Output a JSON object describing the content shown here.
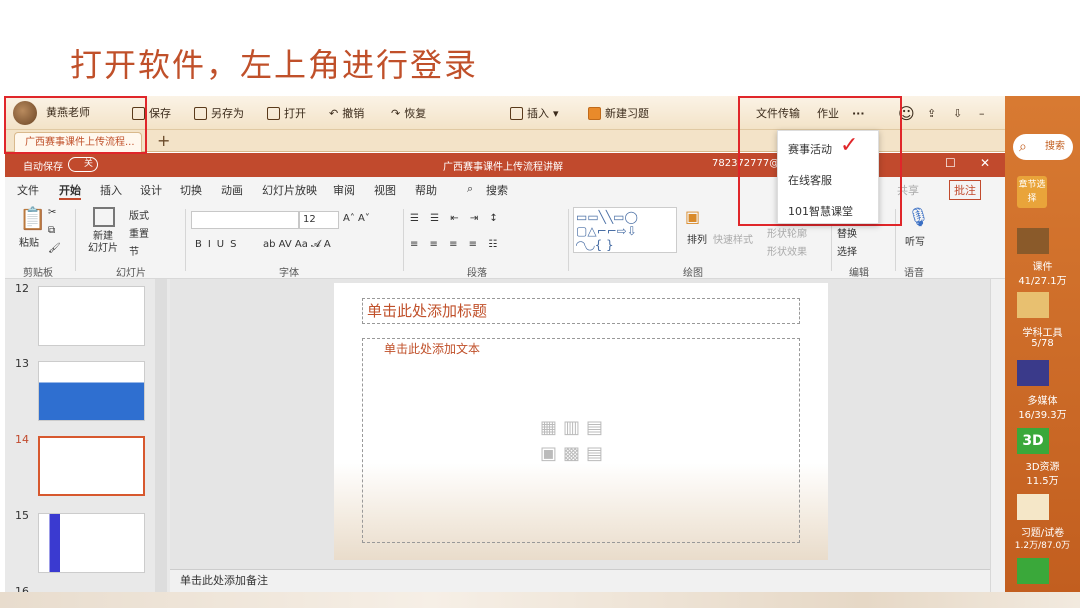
{
  "slide_title": "打开软件，左上角进行登录",
  "app_bar": {
    "user_name": "黄燕老师",
    "save": "保存",
    "save_as": "另存为",
    "open": "打开",
    "undo": "撤销",
    "redo": "恢复",
    "insert": "插入",
    "new_exercise": "新建习题",
    "file_transfer": "文件传输",
    "homework": "作业",
    "more": "···"
  },
  "doc_tab": {
    "label": "广西赛事课件上传流程..."
  },
  "new_tab": "+",
  "ppt": {
    "autosave": "自动保存",
    "autosave_state": "关",
    "window_title": "广西赛事课件上传流程讲解",
    "user": "782372777@q",
    "ribbon_tabs": [
      "文件",
      "开始",
      "插入",
      "设计",
      "切换",
      "动画",
      "幻灯片放映",
      "审阅",
      "视图",
      "帮助",
      "搜索"
    ],
    "share": "共享",
    "annotate": "批注",
    "paste": "粘贴",
    "new_slide": "新建\n幻灯片",
    "layout": "版式",
    "reset": "重置",
    "section": "节",
    "font_size": "12",
    "arrange": "排列",
    "quick_styles": "快速样式",
    "shape_outline": "形状轮廓",
    "shape_effect": "形状效果",
    "replace": "替换",
    "select": "选择",
    "dictate": "听写",
    "groups": [
      "剪贴板",
      "幻灯片",
      "字体",
      "段落",
      "绘图",
      "编辑",
      "语音"
    ],
    "thumb_numbers": [
      "12",
      "13",
      "14",
      "15",
      "16"
    ],
    "title_placeholder": "单击此处添加标题",
    "body_placeholder": "单击此处添加文本",
    "notes_placeholder": "单击此处添加备注"
  },
  "dropdown": {
    "items": [
      "赛事活动",
      "在线客服",
      "101智慧课堂"
    ]
  },
  "right_bar": {
    "search": "搜索",
    "chapter_select": "章节选择",
    "items": [
      {
        "label": "课件",
        "count": "41/27.1万"
      },
      {
        "label": "学科工具",
        "count": "5/78"
      },
      {
        "label": "多媒体",
        "count": "16/39.3万"
      },
      {
        "label": "3D资源",
        "count": "11.5万"
      },
      {
        "label": "习题/试卷",
        "count": "1.2万/87.0万"
      }
    ]
  },
  "colors": {
    "accent": "#c0502a",
    "ppt_title": "#c14a2d",
    "highlight_box": "#e0262a",
    "sidebar": "#d87a32"
  }
}
